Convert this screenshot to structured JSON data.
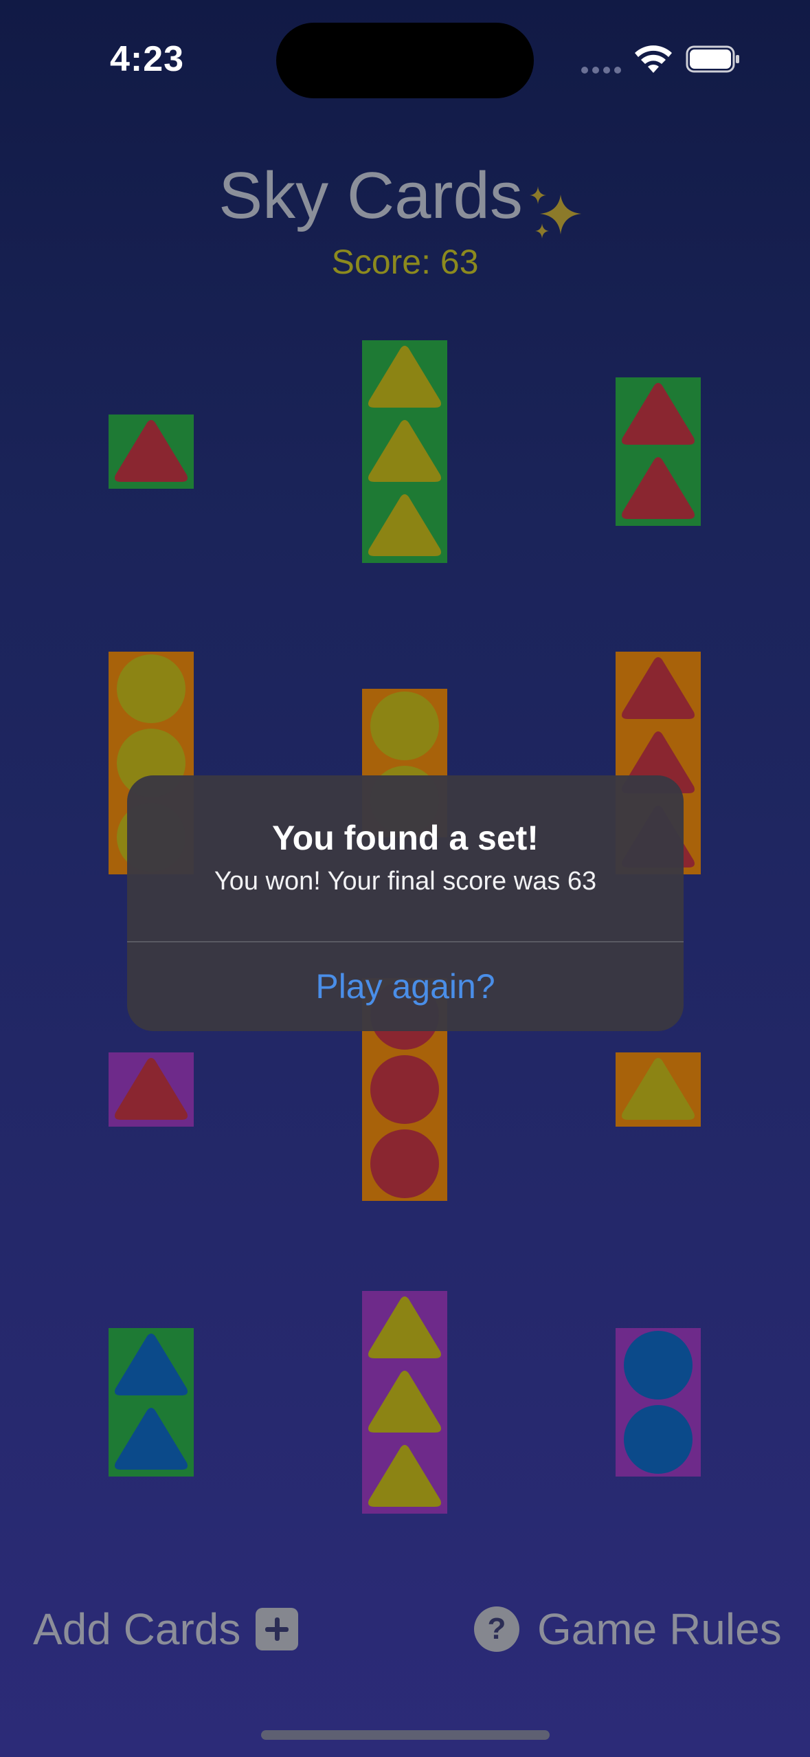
{
  "status_bar": {
    "time": "4:23"
  },
  "header": {
    "title": "Sky Cards",
    "title_emoji": "sparkles-icon",
    "score_text": "Score: 63"
  },
  "colors": {
    "green": "#1e7a34",
    "orange": "#a8620a",
    "purple": "#6e2a8a",
    "red": "#8a2630",
    "yellow": "#8c8414",
    "blue": "#0b4a8a"
  },
  "cards": [
    {
      "background": "green",
      "shape": "triangle",
      "color": "red",
      "count": 1
    },
    {
      "background": "green",
      "shape": "triangle",
      "color": "yellow",
      "count": 3
    },
    {
      "background": "green",
      "shape": "triangle",
      "color": "red",
      "count": 2
    },
    {
      "background": "orange",
      "shape": "circle",
      "color": "yellow",
      "count": 3
    },
    {
      "background": "orange",
      "shape": "circle",
      "color": "yellow",
      "count": 2
    },
    {
      "background": "orange",
      "shape": "triangle",
      "color": "red",
      "count": 3
    },
    {
      "background": "purple",
      "shape": "triangle",
      "color": "red",
      "count": 1
    },
    {
      "background": "orange",
      "shape": "circle",
      "color": "red",
      "count": 3
    },
    {
      "background": "orange",
      "shape": "triangle",
      "color": "yellow",
      "count": 1
    },
    {
      "background": "green",
      "shape": "triangle",
      "color": "blue",
      "count": 2
    },
    {
      "background": "purple",
      "shape": "triangle",
      "color": "yellow",
      "count": 3
    },
    {
      "background": "purple",
      "shape": "circle",
      "color": "blue",
      "count": 2
    }
  ],
  "alert": {
    "title": "You found a set!",
    "message": "You won! Your final score was 63",
    "button_label": "Play again?"
  },
  "bottom_bar": {
    "add_cards_label": "Add Cards",
    "add_cards_icon": "plus-square-icon",
    "game_rules_label": "Game Rules",
    "game_rules_icon": "question-circle-icon"
  }
}
